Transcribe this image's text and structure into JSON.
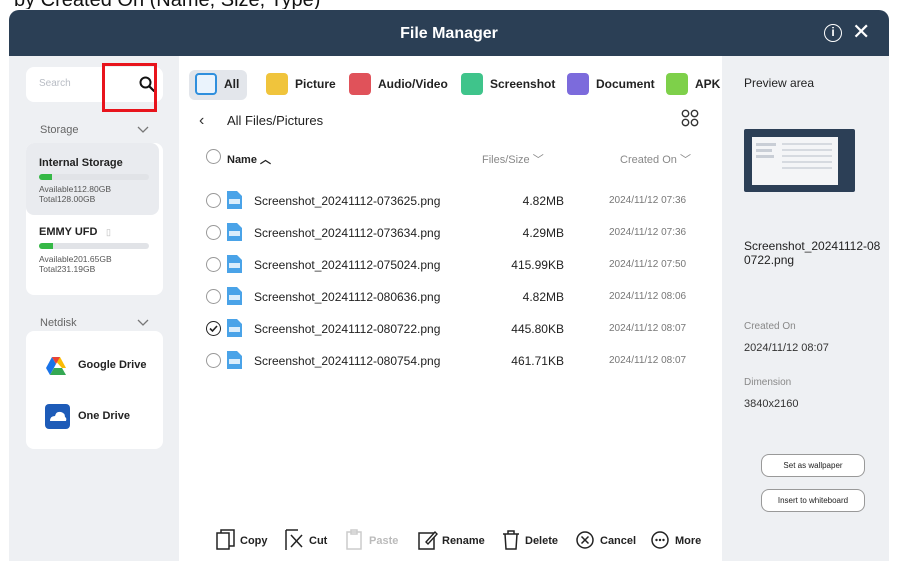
{
  "top_caption": "by Created On (Name, Size, Type)",
  "window": {
    "title": "File Manager"
  },
  "sidebar": {
    "search_placeholder": "Search",
    "storage_heading": "Storage",
    "storage": [
      {
        "name": "Internal Storage",
        "available": "Available112.80GB",
        "total": "Total128.00GB",
        "used_fraction": 0.12
      },
      {
        "name": "EMMY UFD",
        "available": "Available201.65GB",
        "total": "Total231.19GB",
        "used_fraction": 0.13
      }
    ],
    "netdisk_heading": "Netdisk",
    "netdisks": [
      {
        "label": "Google Drive"
      },
      {
        "label": "One Drive"
      }
    ]
  },
  "tabs": [
    {
      "label": "All",
      "color": "#2f8fdd"
    },
    {
      "label": "Picture",
      "color": "#f0c43c"
    },
    {
      "label": "Audio/Video",
      "color": "#e0525a"
    },
    {
      "label": "Screenshot",
      "color": "#3fc48b"
    },
    {
      "label": "Document",
      "color": "#7c6bdc"
    },
    {
      "label": "APK",
      "color": "#7ed04a"
    }
  ],
  "breadcrumb": "All Files/Pictures",
  "columns": {
    "name": "Name",
    "size": "Files/Size",
    "created": "Created On"
  },
  "files": [
    {
      "name": "Screenshot_20241112-073625.png",
      "size": "4.82MB",
      "date": "2024/11/12 07:36",
      "selected": false
    },
    {
      "name": "Screenshot_20241112-073634.png",
      "size": "4.29MB",
      "date": "2024/11/12 07:36",
      "selected": false
    },
    {
      "name": "Screenshot_20241112-075024.png",
      "size": "415.99KB",
      "date": "2024/11/12 07:50",
      "selected": false
    },
    {
      "name": "Screenshot_20241112-080636.png",
      "size": "4.82MB",
      "date": "2024/11/12 08:06",
      "selected": false
    },
    {
      "name": "Screenshot_20241112-080722.png",
      "size": "445.80KB",
      "date": "2024/11/12 08:07",
      "selected": true
    },
    {
      "name": "Screenshot_20241112-080754.png",
      "size": "461.71KB",
      "date": "2024/11/12 08:07",
      "selected": false
    }
  ],
  "toolbar": {
    "copy": "Copy",
    "cut": "Cut",
    "paste": "Paste",
    "rename": "Rename",
    "delete": "Delete",
    "cancel": "Cancel",
    "more": "More"
  },
  "preview": {
    "title": "Preview area",
    "filename": "Screenshot_20241112-080722.png",
    "created_label": "Created On",
    "created_value": "2024/11/12 08:07",
    "dimension_label": "Dimension",
    "dimension_value": "3840x2160",
    "set_wallpaper": "Set as wallpaper",
    "insert_whiteboard": "Insert to whiteboard"
  },
  "colors": {
    "titlebar": "#2b3f55",
    "highlight_box": "#e8141c",
    "storage_bar": "#35b846"
  }
}
